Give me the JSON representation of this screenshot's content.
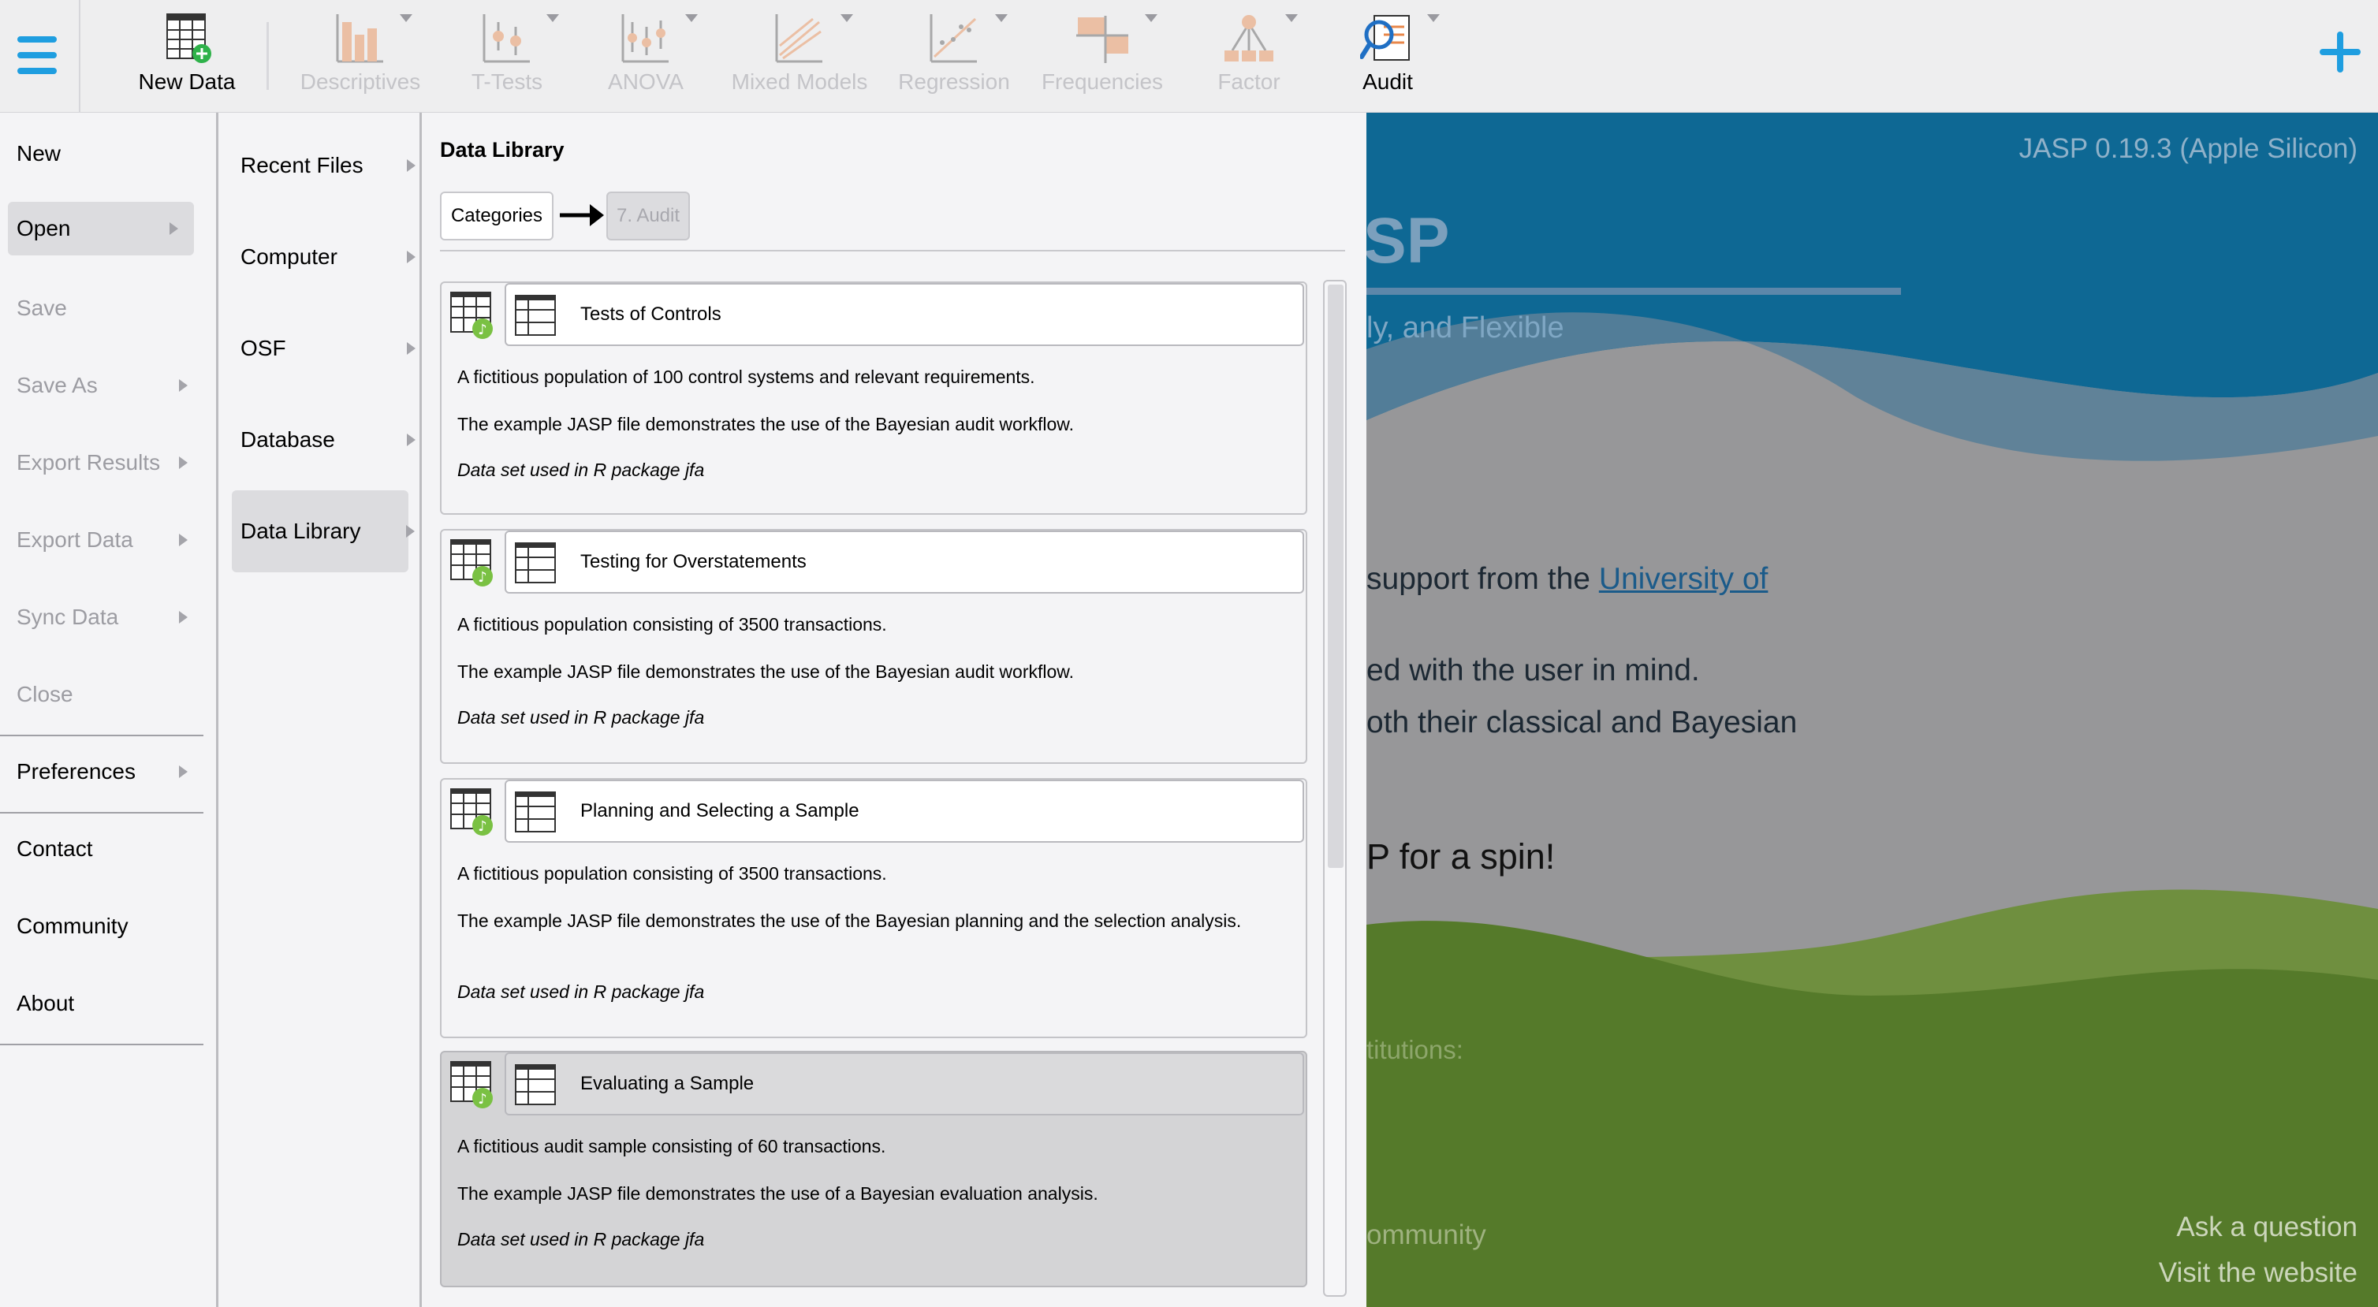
{
  "toolbar": {
    "items": [
      {
        "label": "New Data",
        "icon": "new-data-icon",
        "enabled": true
      },
      {
        "label": "Descriptives",
        "icon": "descriptives-icon",
        "enabled": false
      },
      {
        "label": "T-Tests",
        "icon": "t-tests-icon",
        "enabled": false
      },
      {
        "label": "ANOVA",
        "icon": "anova-icon",
        "enabled": false
      },
      {
        "label": "Mixed Models",
        "icon": "mixed-models-icon",
        "enabled": false
      },
      {
        "label": "Regression",
        "icon": "regression-icon",
        "enabled": false
      },
      {
        "label": "Frequencies",
        "icon": "frequencies-icon",
        "enabled": false
      },
      {
        "label": "Factor",
        "icon": "factor-icon",
        "enabled": false
      },
      {
        "label": "Audit",
        "icon": "audit-icon",
        "enabled": true
      }
    ],
    "colors": {
      "accent": "#1f9ee0",
      "orange": "#e8874a"
    }
  },
  "file_menu": {
    "items": [
      {
        "label": "New",
        "enabled": true,
        "submenu": false
      },
      {
        "label": "Open",
        "enabled": true,
        "submenu": true,
        "selected": true
      },
      {
        "label": "Save",
        "enabled": false,
        "submenu": false
      },
      {
        "label": "Save As",
        "enabled": false,
        "submenu": true
      },
      {
        "label": "Export Results",
        "enabled": false,
        "submenu": true
      },
      {
        "label": "Export Data",
        "enabled": false,
        "submenu": true
      },
      {
        "label": "Sync Data",
        "enabled": false,
        "submenu": true
      },
      {
        "label": "Close",
        "enabled": false,
        "submenu": false
      },
      {
        "label": "Preferences",
        "enabled": true,
        "submenu": true
      },
      {
        "label": "Contact",
        "enabled": true,
        "submenu": false
      },
      {
        "label": "Community",
        "enabled": true,
        "submenu": false
      },
      {
        "label": "About",
        "enabled": true,
        "submenu": false
      }
    ]
  },
  "sub_menu": {
    "items": [
      {
        "label": "Recent Files"
      },
      {
        "label": "Computer"
      },
      {
        "label": "OSF"
      },
      {
        "label": "Database"
      },
      {
        "label": "Data Library",
        "selected": true
      }
    ]
  },
  "library": {
    "title": "Data Library",
    "breadcrumb": {
      "categories": "Categories",
      "current": "7. Audit"
    },
    "cards": [
      {
        "name": "Tests of Controls",
        "description": "A fictitious population of 100 control systems and relevant requirements.",
        "example": "The example JASP file demonstrates the use of the Bayesian audit workflow.",
        "source": "Data set used in R package jfa"
      },
      {
        "name": "Testing for Overstatements",
        "description": "A fictitious population consisting of 3500 transactions.",
        "example": "The example JASP file demonstrates the use of the Bayesian audit workflow.",
        "source": "Data set used in R package jfa"
      },
      {
        "name": "Planning and Selecting a Sample",
        "description": "A fictitious population consisting of 3500 transactions.",
        "example": "The example JASP file demonstrates the use of the Bayesian planning and the selection analysis.",
        "source": "Data set used in R package jfa"
      },
      {
        "name": "Evaluating a Sample",
        "description": "A fictitious audit sample consisting of 60 transactions.",
        "example": "The example JASP file demonstrates the use of a Bayesian evaluation analysis.",
        "source": "Data set used in R package jfa",
        "active": true
      }
    ]
  },
  "welcome": {
    "version": "JASP 0.19.3 (Apple Silicon)",
    "logo_fragment": "SP",
    "tagline_fragment": "ly, and Flexible",
    "support_prefix": "support from the ",
    "support_link": "University of",
    "mind_fragment": "ed with the user in mind.",
    "both_fragment": "oth their classical and Bayesian",
    "spin_fragment": "P for a spin!",
    "institutions_fragment": "titutions:",
    "community_fragment": "ommunity",
    "ask": "Ask a question",
    "visit": "Visit the website"
  }
}
